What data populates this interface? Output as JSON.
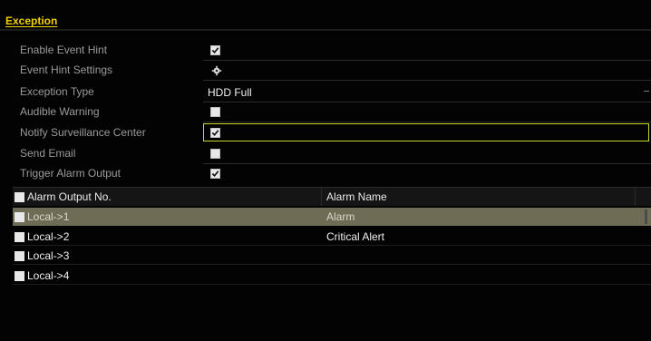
{
  "tab": {
    "label": "Exception"
  },
  "settings": {
    "enable_event_hint": {
      "label": "Enable Event Hint",
      "checked": true
    },
    "event_hint_settings": {
      "label": "Event Hint Settings",
      "icon": "gear-icon"
    },
    "exception_type": {
      "label": "Exception Type",
      "value": "HDD Full"
    },
    "audible_warning": {
      "label": "Audible Warning",
      "checked": false
    },
    "notify_center": {
      "label": "Notify Surveillance Center",
      "checked": true
    },
    "send_email": {
      "label": "Send Email",
      "checked": false
    },
    "trigger_alarm": {
      "label": "Trigger Alarm Output",
      "checked": true
    }
  },
  "table": {
    "headers": {
      "output_no": "Alarm Output No.",
      "alarm_name": "Alarm Name"
    },
    "rows": [
      {
        "output": "Local->1",
        "name": "Alarm",
        "selected": true
      },
      {
        "output": "Local->2",
        "name": "Critical Alert",
        "selected": false
      },
      {
        "output": "Local->3",
        "name": "",
        "selected": false
      },
      {
        "output": "Local->4",
        "name": "",
        "selected": false
      }
    ]
  },
  "colors": {
    "tab_accent": "#f0d000",
    "focus_border": "#c9d82a",
    "selected_row": "#6e6c55"
  }
}
